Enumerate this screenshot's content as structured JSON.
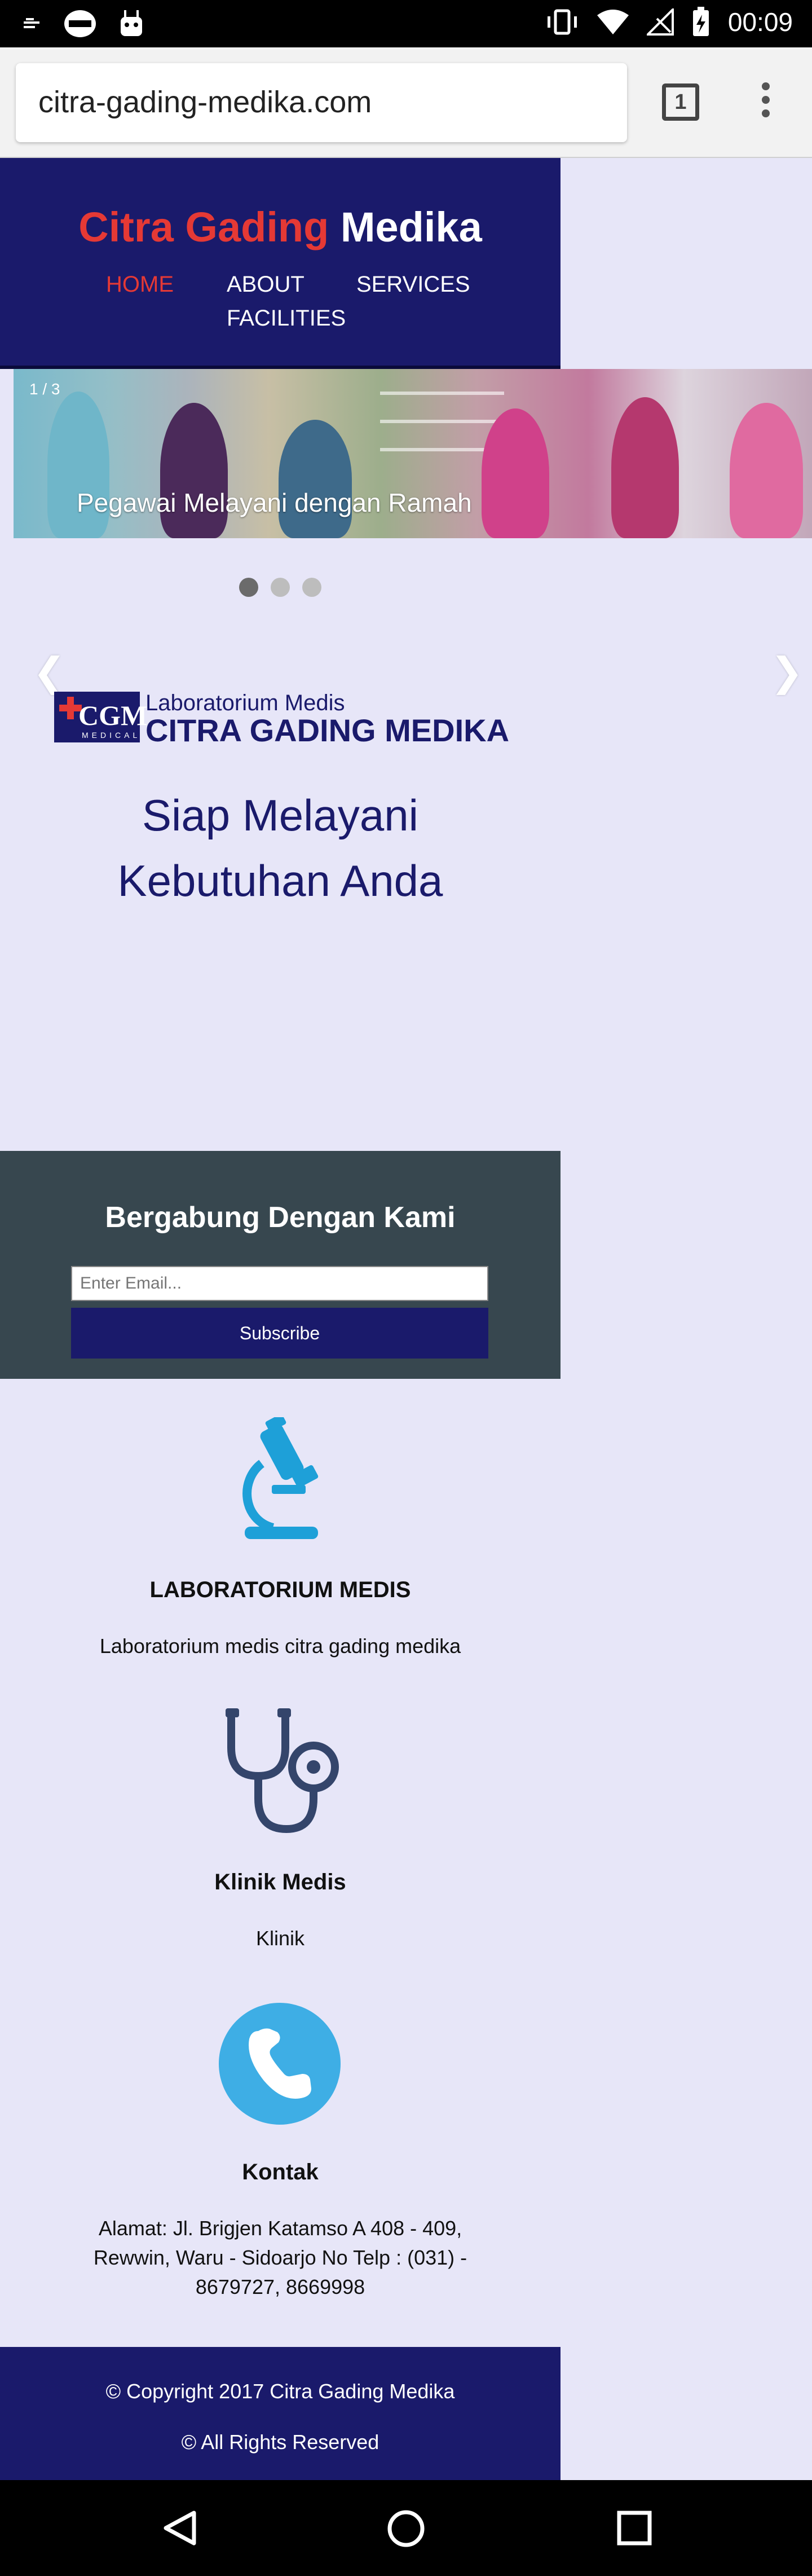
{
  "status_bar": {
    "time": "00:09"
  },
  "browser": {
    "url": "citra-gading-medika.com",
    "tab_count": "1"
  },
  "header": {
    "brand_part1": "Citra Gading",
    "brand_part2": "Medika",
    "nav": [
      "HOME",
      "ABOUT",
      "SERVICES",
      "FACILITIES"
    ],
    "active_nav": "HOME",
    "active_color": "#e53935",
    "background": "#1a1a6b"
  },
  "slider": {
    "counter": "1 / 3",
    "caption": "Pegawai Melayani dengan Ramah",
    "prev_arrow": "❮",
    "next_arrow": "❯",
    "active_dot": 1,
    "total_dots": 3
  },
  "logo": {
    "abbr": "CGM",
    "sub": "MEDICAL",
    "line1": "Laboratorium Medis",
    "line2": "CITRA GADING MEDIKA"
  },
  "tagline": {
    "line1": "Siap Melayani",
    "line2": "Kebutuhan Anda"
  },
  "subscribe": {
    "title": "Bergabung Dengan Kami",
    "placeholder": "Enter Email...",
    "button": "Subscribe"
  },
  "features": [
    {
      "icon": "microscope-icon",
      "title": "LABORATORIUM MEDIS",
      "text": "Laboratorium medis citra gading medika"
    },
    {
      "icon": "stethoscope-icon",
      "title": "Klinik Medis",
      "text": "Klinik"
    },
    {
      "icon": "phone-icon",
      "title": "Kontak",
      "text": "Alamat: Jl. Brigjen Katamso A 408 - 409, Rewwin, Waru - Sidoarjo No Telp : (031) - 8679727, 8669998"
    }
  ],
  "footer": {
    "copyright": "© Copyright 2017 Citra Gading Medika",
    "rights": "© All Rights Reserved"
  }
}
